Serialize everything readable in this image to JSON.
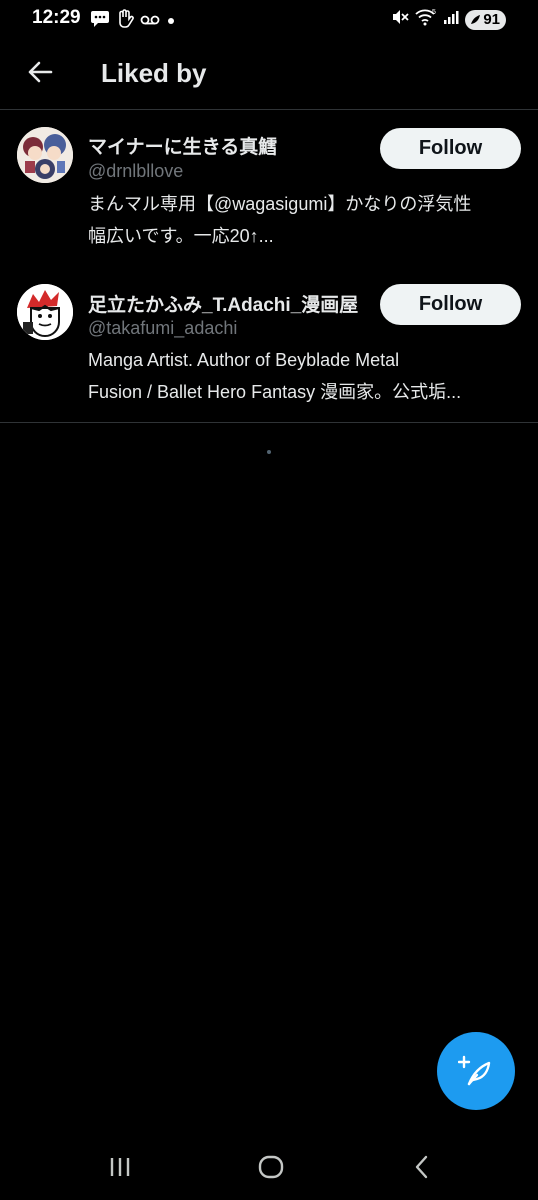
{
  "status_bar": {
    "time": "12:29",
    "battery": "91",
    "icons": [
      "message-icon",
      "hand-icon",
      "voicemail-icon",
      "dot-icon",
      "mute-icon",
      "wifi-icon",
      "signal-icon",
      "battery-icon"
    ]
  },
  "header": {
    "title": "Liked by",
    "back_icon": "arrow-left-icon"
  },
  "users": [
    {
      "display_name": "マイナーに生きる真鱈",
      "handle": "@drnlbllove",
      "bio_line1": "まんマル専用【@wagasigumi】かなりの浮気性",
      "bio_line2": "幅広いです。一応20↑...",
      "follow_label": "Follow"
    },
    {
      "display_name": "足立たかふみ_T.Adachi_漫画屋",
      "handle": "@takafumi_adachi",
      "bio_line1": "Manga Artist. Author of Beyblade Metal",
      "bio_line2": "Fusion / Ballet Hero Fantasy 漫画家。公式垢...",
      "follow_label": "Follow"
    }
  ],
  "fab": {
    "icon": "compose-feather-icon"
  },
  "nav_bar": {
    "icons": [
      "recent-apps-icon",
      "home-icon",
      "back-icon"
    ]
  },
  "colors": {
    "background": "#000000",
    "text": "#e7e9ea",
    "secondary_text": "#71767b",
    "divider": "#2f3336",
    "follow_bg": "#eff3f4",
    "accent": "#1d9bf0"
  }
}
